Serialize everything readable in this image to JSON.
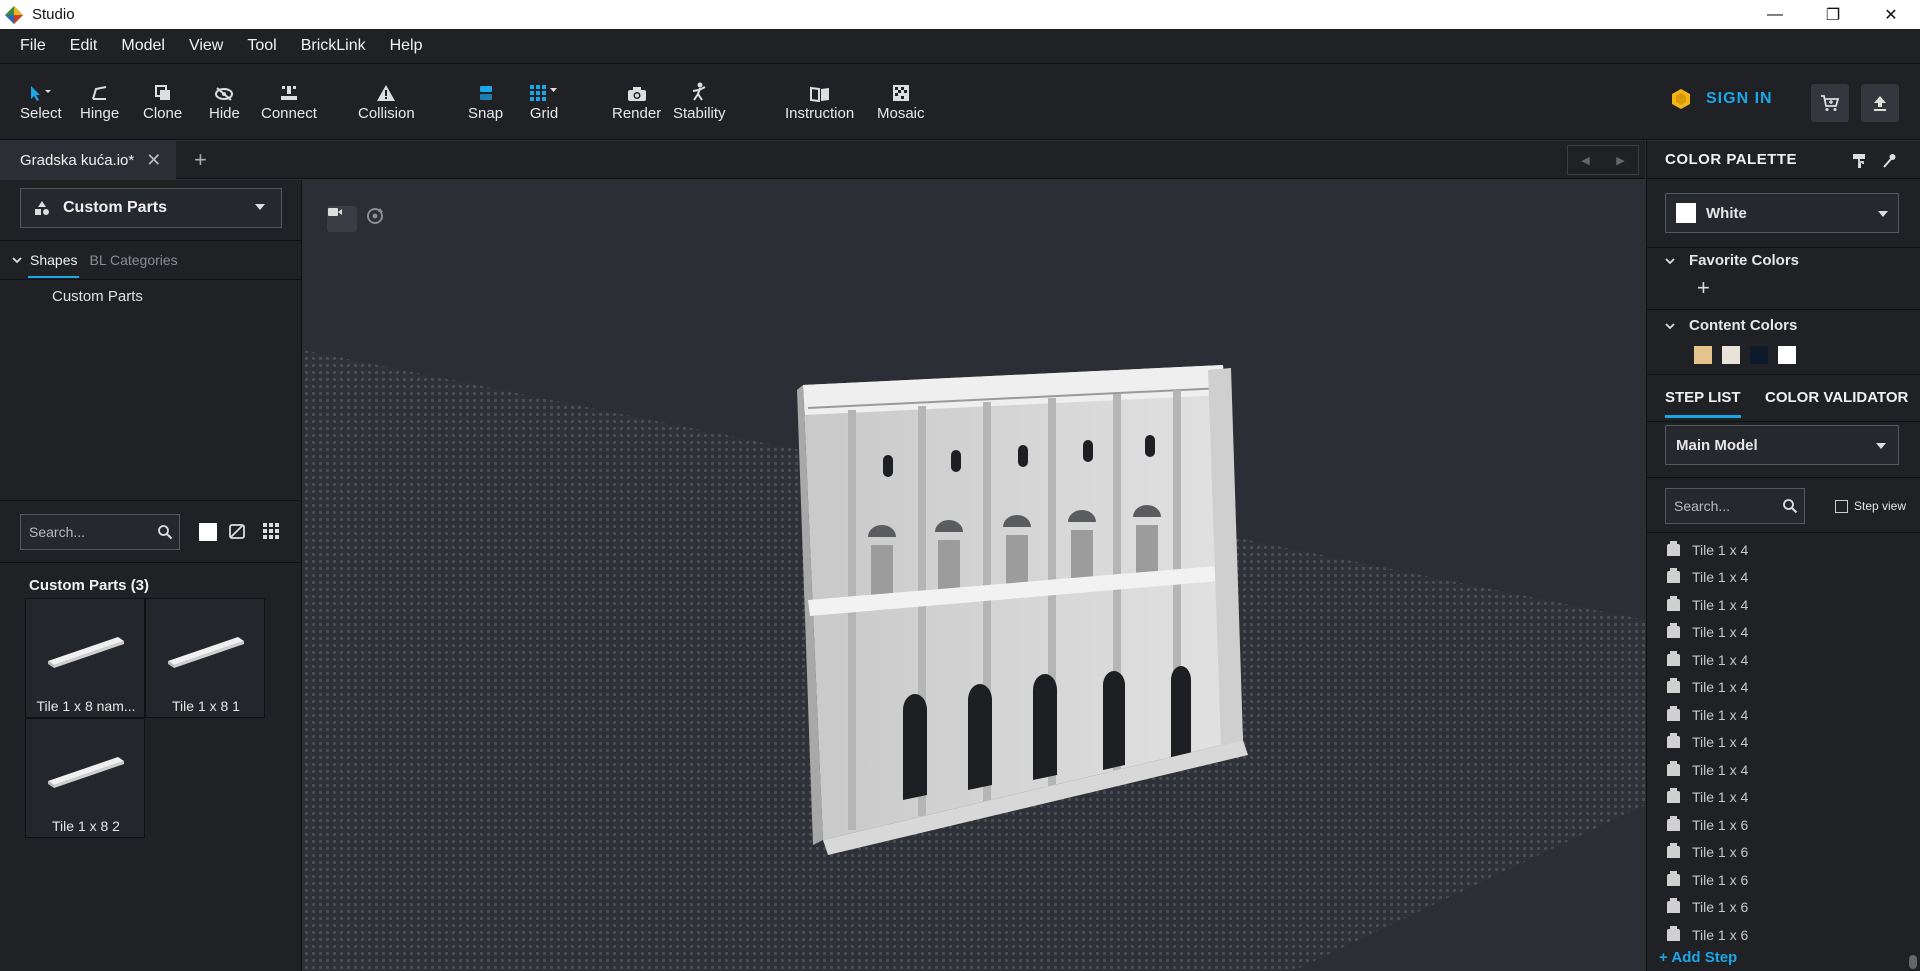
{
  "app": {
    "title": "Studio"
  },
  "window_controls": {
    "minimize": "—",
    "maximize": "❐",
    "close": "✕"
  },
  "menu": [
    "File",
    "Edit",
    "Model",
    "View",
    "Tool",
    "BrickLink",
    "Help"
  ],
  "toolbar": {
    "tools": [
      "Select",
      "Hinge",
      "Clone",
      "Hide",
      "Connect",
      "Collision",
      "Snap",
      "Grid",
      "Render",
      "Stability",
      "Instruction",
      "Mosaic"
    ],
    "sign_in": "SIGN IN"
  },
  "tabs": {
    "document": "Gradska kuća.io*",
    "close": "✕",
    "add": "+"
  },
  "left_panel": {
    "dropdown": "Custom Parts",
    "tab_shapes": "Shapes",
    "tab_bl_categories": "BL Categories",
    "tree_item": "Custom Parts",
    "search_placeholder": "Search...",
    "parts_header": "Custom Parts (3)",
    "parts": [
      "Tile 1 x 8 nam...",
      "Tile 1 x 8 1",
      "Tile 1 x 8 2"
    ]
  },
  "right_panel": {
    "color_palette_title": "COLOR PALETTE",
    "selected_color": "White",
    "favorite_colors_title": "Favorite Colors",
    "fav_add": "+",
    "content_colors_title": "Content Colors",
    "content_colors": [
      "#e4c48c",
      "#e8e2d8",
      "#0c1a2a",
      "#ffffff"
    ],
    "tab_step_list": "STEP LIST",
    "tab_color_validator": "COLOR VALIDATOR",
    "model_select": "Main Model",
    "step_search_placeholder": "Search...",
    "step_view_label": "Step view",
    "steps": [
      "Tile 1 x 4",
      "Tile 1 x 4",
      "Tile 1 x 4",
      "Tile 1 x 4",
      "Tile 1 x 4",
      "Tile 1 x 4",
      "Tile 1 x 4",
      "Tile 1 x 4",
      "Tile 1 x 4",
      "Tile 1 x 4",
      "Tile 1 x 6",
      "Tile 1 x 6",
      "Tile 1 x 6",
      "Tile 1 x 6",
      "Tile 1 x 6"
    ],
    "add_step": "+ Add Step"
  },
  "colors": {
    "accent": "#1aa7e8",
    "panel": "#1f2125",
    "viewport": "#2b2e34"
  }
}
